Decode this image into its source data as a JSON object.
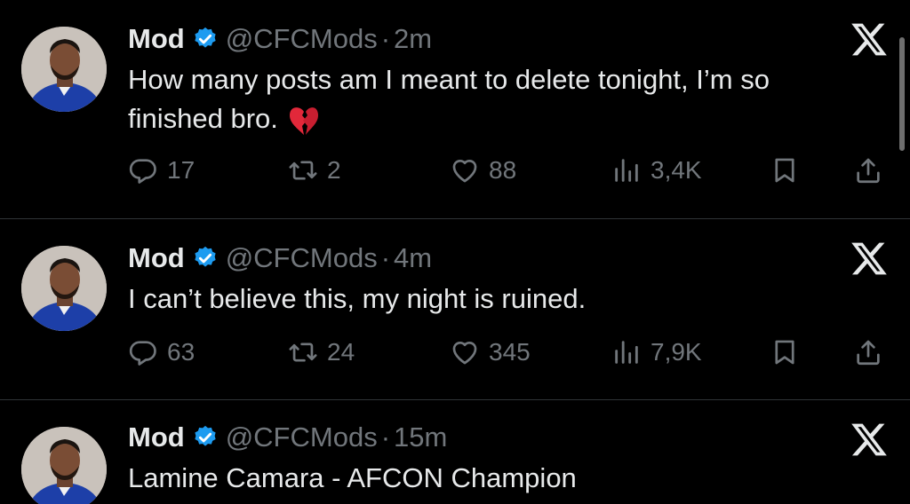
{
  "brand_icon": "x-logo-icon",
  "colors": {
    "background": "#000000",
    "text": "#e7e9ea",
    "secondary": "#71767b",
    "verified": "#1d9bf0",
    "divider": "#2f3336"
  },
  "tweets": [
    {
      "name": "Mod",
      "handle": "@CFCMods",
      "separator": "·",
      "time": "2m",
      "text_line1": "How many posts am I meant to delete tonight, I’m so",
      "text_line2": "finished bro.",
      "emoji": "broken-heart-icon",
      "replies": "17",
      "reposts": "2",
      "likes": "88",
      "views": "3,4K"
    },
    {
      "name": "Mod",
      "handle": "@CFCMods",
      "separator": "·",
      "time": "4m",
      "text_line1": "I can’t believe this, my night is ruined.",
      "replies": "63",
      "reposts": "24",
      "likes": "345",
      "views": "7,9K"
    },
    {
      "name": "Mod",
      "handle": "@CFCMods",
      "separator": "·",
      "time": "15m",
      "text_line1": "Lamine Camara - AFCON Champion"
    }
  ]
}
